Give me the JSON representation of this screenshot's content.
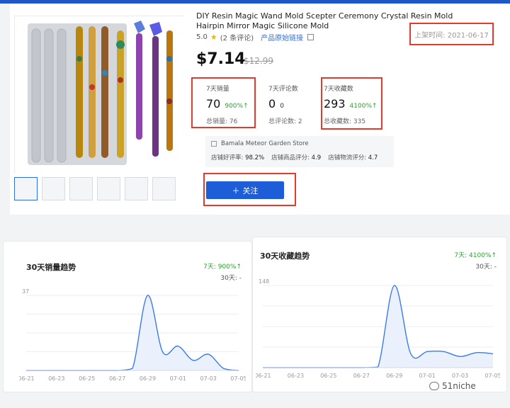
{
  "product": {
    "title": "DIY Resin Magic Wand Mold Scepter Ceremony Crystal Resin Mold Hairpin Mirror Magic Silicone Mold",
    "rating": "5.0",
    "review_count": "(2 条评论)",
    "source_link": "产品原始链接",
    "listed_date": "上架时间: 2021-06-17",
    "price": "$7.14",
    "original_price": "$12.99"
  },
  "stats": {
    "sales": {
      "label": "7天销量",
      "value": "70",
      "change": "900%↑",
      "total": "总销量: 76"
    },
    "reviews": {
      "label": "7天评论数",
      "value": "0",
      "change": "0",
      "total": "总评论数: 2"
    },
    "favorites": {
      "label": "7天收藏数",
      "value": "293",
      "change": "4100%↑",
      "total": "总收藏数: 335"
    }
  },
  "store": {
    "name": "Bamala Meteor Garden Store",
    "positive_label": "店铺好评率:",
    "positive_value": "98.2%",
    "product_score_label": "店铺商品评分:",
    "product_score_value": "4.9",
    "logistics_label": "店铺物流评分:",
    "logistics_value": "4.7"
  },
  "follow_button": {
    "label": "关注"
  },
  "icons": {
    "star": "star-icon",
    "external": "external-link-icon",
    "store": "store-icon",
    "plus": "plus-icon",
    "wechat": "wechat-icon"
  },
  "colors": {
    "accent": "#1d5ed8",
    "highlight": "#e23a2c",
    "up": "#2aa52a",
    "line": "#3b7be9",
    "fill": "#eaf1fd"
  },
  "charts": {
    "sales": {
      "title": "30天销量趋势",
      "kpi_7d": "7天: 900%↑",
      "kpi_30d": "30天: -"
    },
    "favorites": {
      "title": "30天收藏趋势",
      "kpi_7d": "7天: 4100%↑",
      "kpi_30d": "30天: -"
    }
  },
  "chart_data": [
    {
      "type": "area",
      "title": "30天销量趋势",
      "x_ticks": [
        "06-21",
        "06-23",
        "06-25",
        "06-27",
        "06-29",
        "07-01",
        "07-03",
        "07-05"
      ],
      "x": [
        "06-21",
        "06-22",
        "06-23",
        "06-24",
        "06-25",
        "06-26",
        "06-27",
        "06-28",
        "06-29",
        "06-30",
        "07-01",
        "07-02",
        "07-03",
        "07-04",
        "07-05"
      ],
      "values": [
        0,
        0,
        0,
        0,
        0,
        0,
        0,
        1,
        37,
        9,
        12,
        5,
        8,
        1,
        0
      ],
      "ylim": [
        0,
        37
      ],
      "y_ticks": [
        "37"
      ]
    },
    {
      "type": "area",
      "title": "30天收藏趋势",
      "x_ticks": [
        "06-21",
        "06-23",
        "06-25",
        "06-27",
        "06-29",
        "07-01",
        "07-03",
        "07-05"
      ],
      "x": [
        "06-21",
        "06-22",
        "06-23",
        "06-24",
        "06-25",
        "06-26",
        "06-27",
        "06-28",
        "06-29",
        "06-30",
        "07-01",
        "07-02",
        "07-03",
        "07-04",
        "07-05"
      ],
      "values": [
        0,
        0,
        0,
        0,
        0,
        0,
        0,
        1,
        148,
        25,
        29,
        29,
        20,
        27,
        25
      ],
      "ylim": [
        0,
        148
      ],
      "y_ticks": [
        "148"
      ]
    }
  ],
  "watermark": "51niche"
}
